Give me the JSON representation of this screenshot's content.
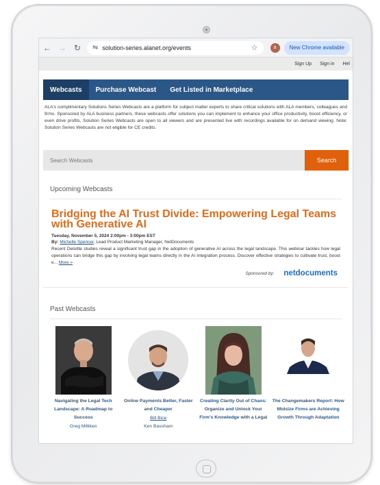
{
  "browser": {
    "url": "solution-series.alanet.org/events",
    "profile_initial": "a",
    "update_label": "New Chrome available"
  },
  "utility": {
    "sign_up": "Sign Up",
    "sign_in": "Sign in",
    "help": "Hel"
  },
  "nav": {
    "tabs": [
      "Webcasts",
      "Purchase Webcast",
      "Get Listed in Marketplace"
    ]
  },
  "intro": "ALA's complimentary Solutions Series Webcasts are a platform for subject matter experts to share critical solutions with ALA members, colleagues and firms. Sponsored by ALA business partners, these webcasts offer solutions you can implement to enhance your office productivity, boost efficiency, or even drive profits. Solution Series Webcasts are open to all viewers and are presented live with recordings available for on demand viewing. Note: Solution Series Webcasts are not eligible for CE credits.",
  "search": {
    "placeholder": "Search Webcasts",
    "button": "Search"
  },
  "upcoming": {
    "heading": "Upcoming Webcasts",
    "title": "Bridging the AI Trust Divide: Empowering Legal Teams with Generative AI",
    "date": "Tuesday, November 5, 2024 2:00pm - 3:00pm EST",
    "by_label": "By:",
    "speaker": "Michelle Spencer",
    "speaker_role": ", Lead Product Marketing Manager, NetDocuments",
    "description": "Recent Deloitte studies reveal a significant trust gap in the adoption of generative AI across the legal landscape. This webinar tackles how legal operations can bridge this gap by involving legal teams directly in the AI integration process. Discover effective strategies to cultivate trust, boost e...",
    "more": "More »",
    "sponsored_by": "Sponsored by:",
    "sponsor": "netdocuments"
  },
  "past": {
    "heading": "Past Webcasts",
    "cards": [
      {
        "title": "Navigating the Legal Tech Landscape: A Roadmap to Success",
        "name": "Greg Milliken"
      },
      {
        "title": "Online Payments Better, Faster and Cheaper",
        "name": "Bill Bice",
        "name2": "Ken Bassham"
      },
      {
        "title": "Creating Clarity Out of Chaos: Organize and Unlock Your Firm's Knowledge with a Legal",
        "name": ""
      },
      {
        "title": "The Changemakers Report: How Midsize Firms are Achieving Growth Through Adaptation",
        "name": ""
      }
    ]
  },
  "colors": {
    "nav": "#2b5788",
    "accent": "#e0600c",
    "link": "#2b5788"
  }
}
